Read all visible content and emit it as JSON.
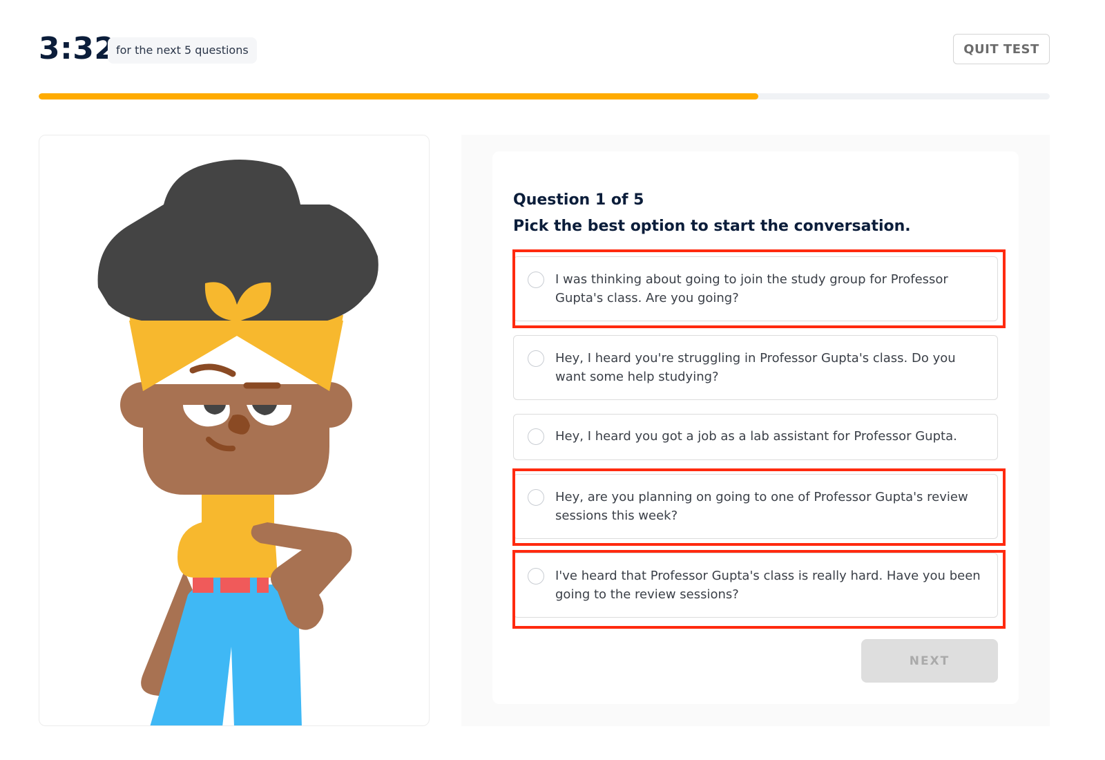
{
  "header": {
    "timer": "3:32",
    "timer_note": "for the next 5 questions",
    "quit_label": "QUIT TEST"
  },
  "progress": {
    "fraction": 0.712,
    "fill_color": "#ffab00",
    "track_color": "#f0f2f5"
  },
  "illustration": {
    "description": "cartoon character with afro hair and yellow headband",
    "colors": {
      "hair": "#444444",
      "headband": "#f7b82e",
      "skin": "#a87252",
      "shirt": "#f7b82e",
      "pants": "#3fb8f5",
      "belt": "#f05a5a",
      "feature": "#8a4a24"
    }
  },
  "question": {
    "number_label": "Question 1 of 5",
    "prompt": "Pick the best option to start the conversation.",
    "options": [
      {
        "text": "I was thinking about going to join the study group for Professor Gupta's class. Are you going?",
        "selected": false,
        "highlighted": true
      },
      {
        "text": "Hey, I heard you're struggling in Professor Gupta's class. Do you want some help studying?",
        "selected": false,
        "highlighted": false
      },
      {
        "text": "Hey, I heard you got a job as a lab assistant for Professor Gupta.",
        "selected": false,
        "highlighted": false
      },
      {
        "text": "Hey, are you planning on going to one of Professor Gupta's review sessions this week?",
        "selected": false,
        "highlighted": true
      },
      {
        "text": "I've heard that Professor Gupta's class is really hard. Have you been going to the review sessions?",
        "selected": false,
        "highlighted": true
      }
    ],
    "next_label": "NEXT",
    "next_enabled": false
  },
  "annotation_color": "#ff2a0f"
}
